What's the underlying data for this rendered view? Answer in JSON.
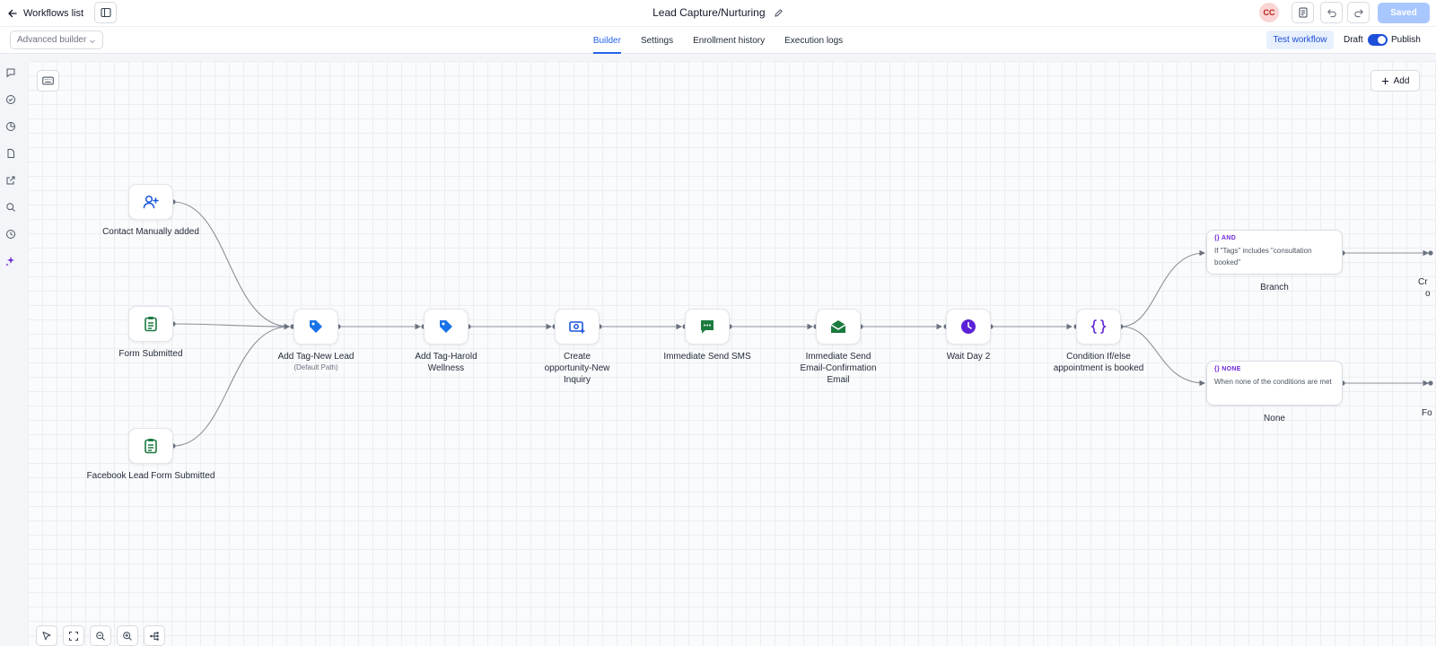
{
  "header": {
    "back_label": "Workflows list",
    "title": "Lead Capture/Nurturing",
    "avatar_initials": "CC",
    "saved_label": "Saved"
  },
  "subbar": {
    "builder_mode": "Advanced builder",
    "tabs": [
      {
        "label": "Builder",
        "active": true
      },
      {
        "label": "Settings",
        "active": false
      },
      {
        "label": "Enrollment history",
        "active": false
      },
      {
        "label": "Execution logs",
        "active": false
      }
    ],
    "test_label": "Test workflow",
    "draft_label": "Draft",
    "publish_label": "Publish",
    "publish_enabled": true
  },
  "rail": {
    "icons": [
      "chat-icon",
      "check-circle-icon",
      "pie-chart-icon",
      "file-icon",
      "external-link-icon",
      "search-icon",
      "history-icon",
      "sparkles-icon"
    ]
  },
  "canvas": {
    "add_label": "Add",
    "triggers": [
      {
        "label": "Contact Manually added",
        "icon": "user-plus-icon"
      },
      {
        "label": "Form Submitted",
        "icon": "clipboard-icon"
      },
      {
        "label": "Facebook Lead Form Submitted",
        "icon": "clipboard-icon"
      }
    ],
    "actions": [
      {
        "label": "Add Tag-New Lead",
        "sublabel": "(Default Path)",
        "icon": "tag-icon"
      },
      {
        "label": "Add Tag-Harold Wellness",
        "icon": "tag-icon"
      },
      {
        "label": "Create opportunity-New Inquiry",
        "icon": "opportunity-icon"
      },
      {
        "label": "Immediate Send SMS",
        "icon": "sms-icon"
      },
      {
        "label": "Immediate Send Email-Confirmation Email",
        "icon": "email-icon"
      },
      {
        "label": "Wait Day 2",
        "icon": "clock-icon"
      },
      {
        "label": "Condition If/else appointment is booked",
        "icon": "braces-icon"
      }
    ],
    "branches": [
      {
        "tag": "AND",
        "text": "If \"Tags\" includes \"consultation booked\"",
        "label": "Branch",
        "next_label_fragment": "Cr",
        "next_label_fragment_2": "o"
      },
      {
        "tag": "NONE",
        "text": "When none of the conditions are met",
        "label": "None",
        "next_label_fragment": "Fo"
      }
    ]
  },
  "colors": {
    "accent": "#2563eb",
    "tag_blue": "#1a73e8",
    "green": "#1b7a3e",
    "purple": "#5b21d6"
  }
}
